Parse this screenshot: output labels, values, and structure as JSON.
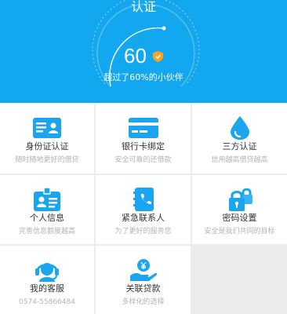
{
  "header": {
    "title": "认证",
    "score": "60",
    "score_badge_icon": "shield-badge-icon",
    "subtitle": "超过了60%的小伙伴",
    "color": "#13a7ef",
    "badge_color": "#f5a623"
  },
  "grid": {
    "accent": "#1ba5ee",
    "items": [
      {
        "label": "身份证认证",
        "desc": "随时随地更好的借贷",
        "icon": "id-card-icon"
      },
      {
        "label": "银行卡绑定",
        "desc": "安全可靠的还借款",
        "icon": "bank-card-icon"
      },
      {
        "label": "三方认证",
        "desc": "信用越高借贷越高",
        "icon": "water-drop-icon"
      },
      {
        "label": "个人信息",
        "desc": "完善信息额度越高",
        "icon": "personal-badge-icon"
      },
      {
        "label": "紧急联系人",
        "desc": "为了更好的服务您",
        "icon": "contact-book-icon"
      },
      {
        "label": "密码设置",
        "desc": "安全是我们共同的目标",
        "icon": "lock-icon"
      },
      {
        "label": "我的客服",
        "desc": "0574-55866484",
        "icon": "headset-icon"
      },
      {
        "label": "关联贷款",
        "desc": "多样化的选择",
        "icon": "coin-hand-icon"
      }
    ]
  }
}
